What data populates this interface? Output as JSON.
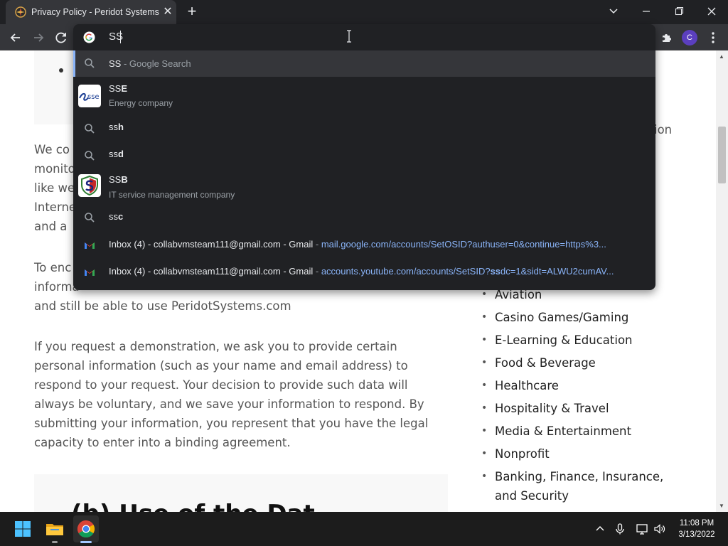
{
  "browser": {
    "tab_title": "Privacy Policy - Peridot Systems",
    "tab_close_glyph": "✕",
    "new_tab_glyph": "+",
    "profile_initial": "C",
    "accent_color": "#8ab4f8"
  },
  "omnibox": {
    "typed_text": "SS",
    "suggestions": [
      {
        "type": "search",
        "main": "SS",
        "suffix": " - Google Search",
        "icon": "search-icon",
        "selected": true
      },
      {
        "type": "entity",
        "prefix": "SS",
        "bold": "E",
        "description": "Energy company",
        "icon": "sse-logo"
      },
      {
        "type": "search",
        "prefix": "ss",
        "bold": "h",
        "icon": "search-icon"
      },
      {
        "type": "search",
        "prefix": "ss",
        "bold": "d",
        "icon": "search-icon"
      },
      {
        "type": "entity",
        "prefix": "SS",
        "bold": "B",
        "description": "IT service management company",
        "icon": "ssb-logo"
      },
      {
        "type": "search",
        "prefix": "ss",
        "bold": "c",
        "icon": "search-icon"
      },
      {
        "type": "history",
        "title": "Inbox (4) - collabvmsteam111@gmail.com - Gmail",
        "separator": " - ",
        "url": "mail.google.com/accounts/SetOSID?authuser=0&continue=https%3...",
        "icon": "gmail-icon"
      },
      {
        "type": "history",
        "title": "Inbox (4) - collabvmsteam111@gmail.com - Gmail",
        "separator": " - ",
        "url_pre": "accounts.youtube.com/accounts/SetSID?",
        "url_bold": "ss",
        "url_post": "dc=1&sidt=ALWU2cumAV...",
        "icon": "gmail-icon"
      }
    ]
  },
  "page": {
    "left_frags": [
      "We co",
      "monito",
      "like we",
      "Interne",
      "and a"
    ],
    "para_cookies_line1": "To enc",
    "para_cookies_line2": "informa",
    "para_cookies_line3": "and still be able to use PeridotSystems.com",
    "para_demo": [
      "If you request a demonstration, we ask you to provide certain",
      "personal information (such as your name and email address) to",
      "respond to your request. Your decision to provide such data will",
      "always be voluntary, and we save your information to respond.  By",
      "submitting your information, you represent that you have the legal",
      "capacity to enter into a binding agreement."
    ],
    "heading_frag": "(b) Use of the Dat",
    "right_frag": "ion",
    "industries": [
      "Aviation",
      "Casino Games/Gaming",
      "E-Learning & Education",
      "Food & Beverage",
      "Healthcare",
      "Hospitality & Travel",
      "Media & Entertainment",
      "Nonprofit",
      "Banking, Finance, Insurance, and Security"
    ]
  },
  "taskbar": {
    "time": "11:08 PM",
    "date": "3/13/2022"
  }
}
